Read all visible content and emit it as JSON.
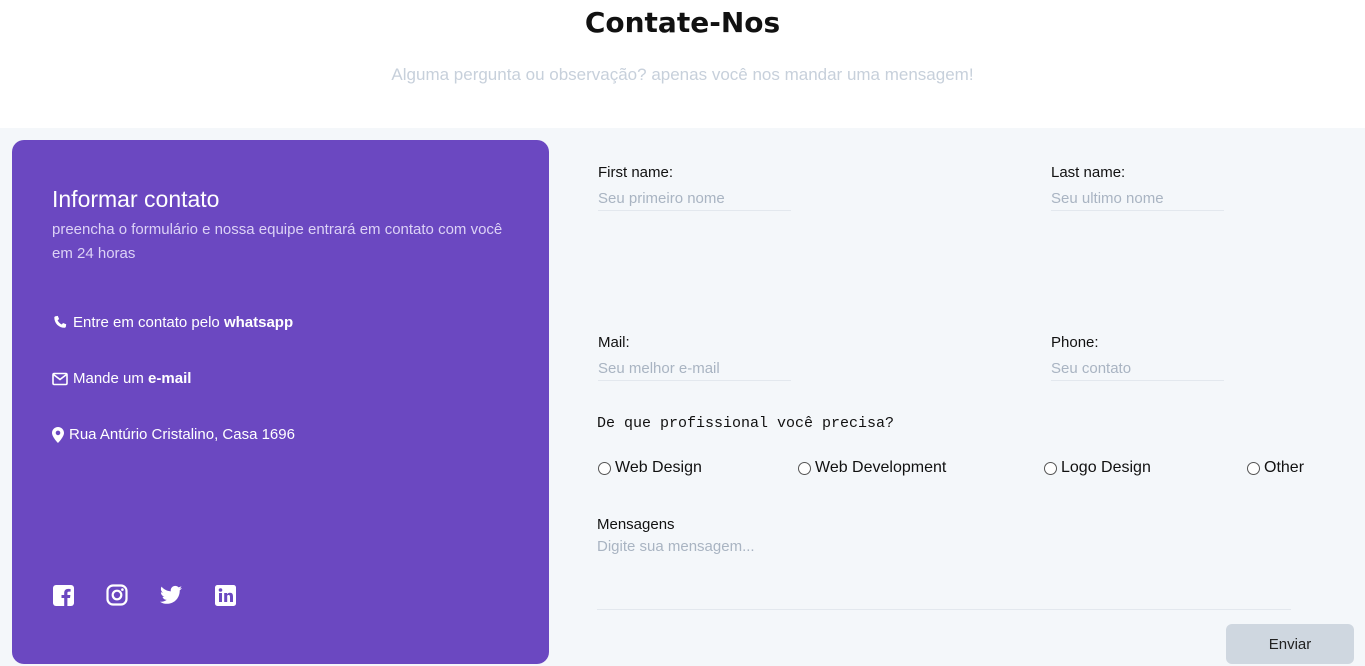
{
  "header": {
    "title": "Contate-Nos",
    "subtitle": "Alguma pergunta ou observação? apenas você nos mandar uma mensagem!"
  },
  "info": {
    "title": "Informar contato",
    "description": "preencha o formulário e nossa equipe entrará em contato com você em 24 horas",
    "phone_text": "Entre em contato pelo",
    "phone_link": "whatsapp",
    "mail_text": "Mande um",
    "mail_link": "e-mail",
    "address": "Rua Antúrio Cristalino, Casa 1696",
    "socials": [
      "facebook-icon",
      "instagram-icon",
      "twitter-icon",
      "linkedin-icon"
    ],
    "card_color": "#6b48c1"
  },
  "form": {
    "first_name": {
      "label": "First name:",
      "placeholder": "Seu primeiro nome"
    },
    "last_name": {
      "label": "Last name:",
      "placeholder": "Seu ultimo nome"
    },
    "mail": {
      "label": "Mail:",
      "placeholder": "Seu melhor e-mail"
    },
    "phone": {
      "label": "Phone:",
      "placeholder": "Seu contato"
    },
    "question": "De que profissional você precisa?",
    "options": [
      "Web Design",
      "Web Development",
      "Logo Design",
      "Other"
    ],
    "message": {
      "label": "Mensagens",
      "placeholder": "Digite sua mensagem..."
    },
    "submit_label": "Enviar"
  }
}
